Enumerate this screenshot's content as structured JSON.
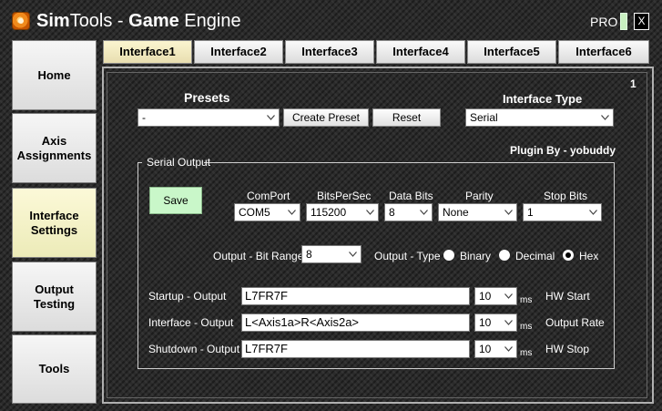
{
  "titlebar": {
    "app_name_light": "Sim",
    "app_name_light2": "Tools - ",
    "app_name_bold": "Game",
    "app_name_tail": " Engine",
    "pro_label": "PRO",
    "close_label": "X"
  },
  "tabs": [
    {
      "label": "Interface1",
      "active": true
    },
    {
      "label": "Interface2",
      "active": false
    },
    {
      "label": "Interface3",
      "active": false
    },
    {
      "label": "Interface4",
      "active": false
    },
    {
      "label": "Interface5",
      "active": false
    },
    {
      "label": "Interface6",
      "active": false
    }
  ],
  "sidebar": {
    "items": [
      {
        "label": "Home"
      },
      {
        "label": "Axis\nAssignments"
      },
      {
        "label": "Interface\nSettings",
        "active": true
      },
      {
        "label": "Output\nTesting"
      },
      {
        "label": "Tools"
      }
    ]
  },
  "panel": {
    "page_number": "1",
    "presets_heading": "Presets",
    "presets_value": "-",
    "create_preset_label": "Create Preset",
    "reset_label": "Reset",
    "interface_type_heading": "Interface Type",
    "interface_type_value": "Serial",
    "plugin_by": "Plugin By - yobuddy"
  },
  "serial_output": {
    "group_title": "Serial Output",
    "save_label": "Save",
    "comport_label": "ComPort",
    "comport_value": "COM5",
    "bps_label": "BitsPerSec",
    "bps_value": "115200",
    "databits_label": "Data Bits",
    "databits_value": "8",
    "parity_label": "Parity",
    "parity_value": "None",
    "stopbits_label": "Stop Bits",
    "stopbits_value": "1",
    "bitrange_label": "Output - Bit Range",
    "bitrange_value": "8",
    "outtype_label": "Output - Type",
    "type_options": [
      {
        "label": "Binary",
        "checked": false
      },
      {
        "label": "Decimal",
        "checked": false
      },
      {
        "label": "Hex",
        "checked": true
      }
    ],
    "rows": [
      {
        "label": "Startup - Output",
        "value": "L7FR7F",
        "delay": "10",
        "unit": "ms",
        "suffix": "HW Start"
      },
      {
        "label": "Interface - Output",
        "value": "L<Axis1a>R<Axis2a>",
        "delay": "10",
        "unit": "ms",
        "suffix": "Output Rate"
      },
      {
        "label": "Shutdown - Output",
        "value": "L7FR7F",
        "delay": "10",
        "unit": "ms",
        "suffix": "HW Stop"
      }
    ]
  },
  "colors": {
    "tab_active": "#f4edc3",
    "sidebar_active": "#f4f2c8",
    "save_button": "#c9f7c9",
    "pro_toggle": "#c8f0c0"
  }
}
